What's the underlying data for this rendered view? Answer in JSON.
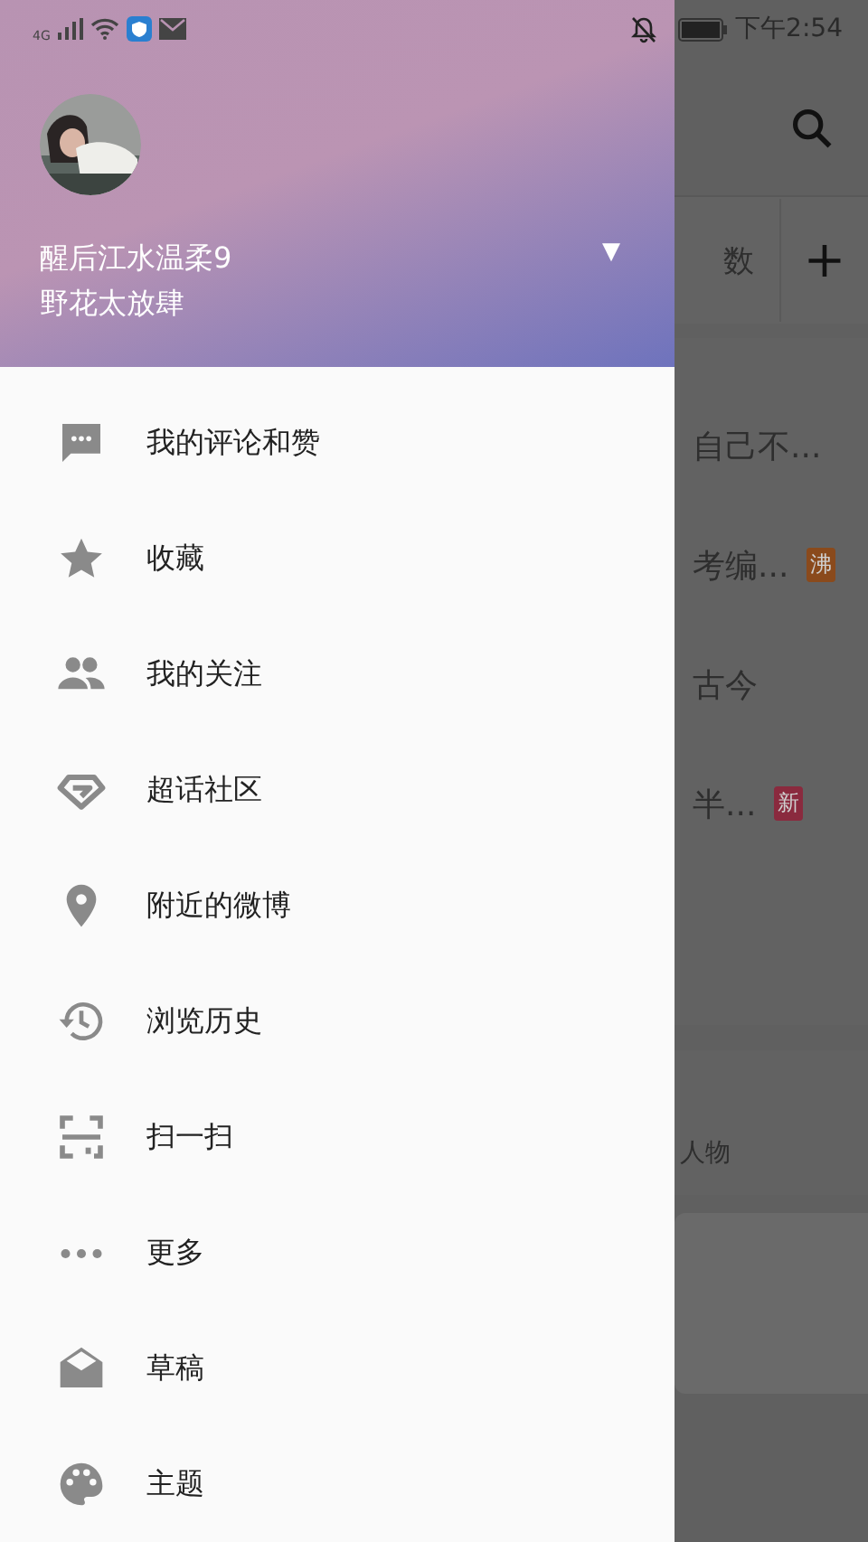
{
  "status_bar": {
    "network": "4G",
    "time": "下午2:54"
  },
  "profile": {
    "name": "醒后江水温柔9",
    "bio": "野花太放肆",
    "dropdown": "▼"
  },
  "menu": [
    {
      "label": "我的评论和赞"
    },
    {
      "label": "收藏"
    },
    {
      "label": "我的关注"
    },
    {
      "label": "超话社区"
    },
    {
      "label": "附近的微博"
    },
    {
      "label": "浏览历史"
    },
    {
      "label": "扫一扫"
    },
    {
      "label": "更多"
    },
    {
      "label": "草稿"
    },
    {
      "label": "主题"
    }
  ],
  "background": {
    "tab_text": "数",
    "add": "+",
    "rows": [
      {
        "text": "自己不..."
      },
      {
        "text": "考编...",
        "badge": "沸",
        "color": "#8a4a1c"
      },
      {
        "text": "古今"
      },
      {
        "text": "半...",
        "badge": "新",
        "color": "#8a2a3e"
      }
    ],
    "section_text": "人物"
  }
}
